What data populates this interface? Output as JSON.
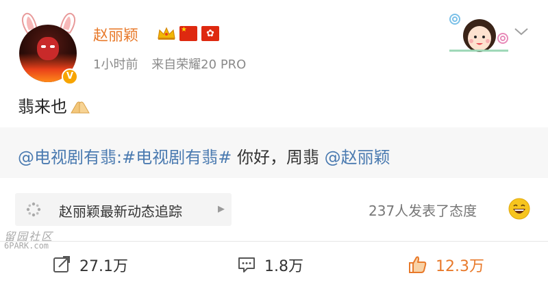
{
  "user": {
    "name": "赵丽颖",
    "verified_badge": "V",
    "icons": [
      "crown-icon",
      "china-flag-icon",
      "hongkong-flag-icon"
    ]
  },
  "meta": {
    "time": "1小时前",
    "source": "来自荣耀20 PRO"
  },
  "post": {
    "text": "翡来也"
  },
  "repost": {
    "mention_1": "@电视剧有翡",
    "separator": ":",
    "hashtag": "#电视剧有翡#",
    "body": " 你好，周翡 ",
    "mention_2": "@赵丽颖"
  },
  "tracker": {
    "label": "赵丽颖最新动态追踪"
  },
  "attitude": {
    "text": "237人发表了态度"
  },
  "watermark": {
    "line1": "留园社区",
    "line2": "6PARK.com"
  },
  "actions": {
    "repost_count": "27.1万",
    "comment_count": "1.8万",
    "like_count": "12.3万"
  },
  "colors": {
    "username": "#e8792a",
    "link": "#4a7ab0",
    "like": "#e8792a",
    "meta": "#8a8a8a"
  }
}
